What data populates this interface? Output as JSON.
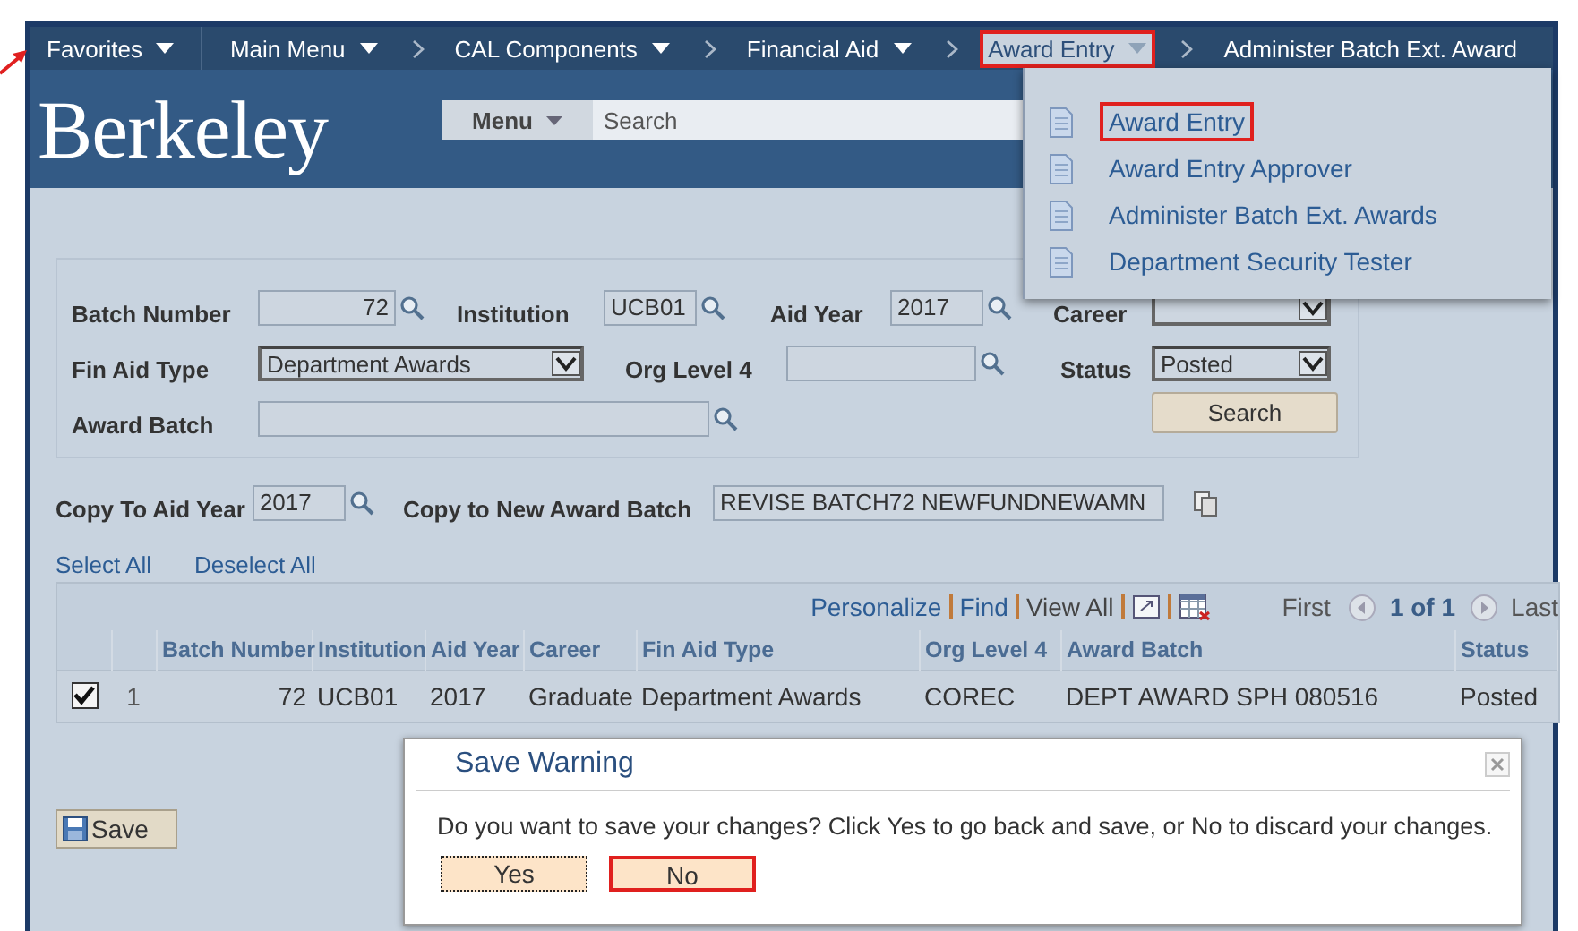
{
  "nav": {
    "items": [
      {
        "label": "Favorites",
        "caret": true,
        "open": false,
        "highlighted": false
      },
      {
        "label": "Main Menu",
        "caret": true,
        "open": false,
        "highlighted": false
      },
      {
        "label": "CAL Components",
        "caret": true,
        "open": false,
        "highlighted": false
      },
      {
        "label": "Financial Aid",
        "caret": true,
        "open": false,
        "highlighted": false
      },
      {
        "label": "Award Entry",
        "caret": true,
        "open": true,
        "highlighted": true
      },
      {
        "label": "Administer Batch Ext. Award",
        "caret": false,
        "open": false,
        "highlighted": false
      }
    ]
  },
  "header": {
    "logo": "Berkeley",
    "menu_button": "Menu",
    "search": {
      "placeholder": "Search"
    }
  },
  "dropdown": {
    "items": [
      {
        "label": "Award Entry",
        "highlighted": true
      },
      {
        "label": "Award Entry Approver",
        "highlighted": false
      },
      {
        "label": "Administer Batch Ext. Awards",
        "highlighted": false
      },
      {
        "label": "Department Security Tester",
        "highlighted": false
      }
    ]
  },
  "search_form": {
    "fields": [
      {
        "label": "Batch Number",
        "kind": "lookup",
        "value": "72"
      },
      {
        "label": "Institution",
        "kind": "lookup",
        "value": "UCB01"
      },
      {
        "label": "Aid Year",
        "kind": "lookup",
        "value": "2017"
      },
      {
        "label": "Career",
        "kind": "select"
      },
      {
        "label": "Fin Aid Type",
        "kind": "select",
        "value": "Department Awards"
      },
      {
        "label": "Org Level 4",
        "kind": "lookup"
      },
      {
        "label": "Status",
        "kind": "select",
        "value": "Posted"
      },
      {
        "label": "Award Batch",
        "kind": "lookup"
      }
    ],
    "search_button": "Search"
  },
  "copy_row": {
    "aid_year_label": "Copy To Aid Year",
    "aid_year": "2017",
    "batch_label": "Copy to New Award Batch",
    "batch": "REVISE BATCH72 NEWFUNDNEWAMN"
  },
  "links": [
    "Select All",
    "Deselect All"
  ],
  "grid": {
    "toolbar": [
      "Personalize",
      "Find",
      "View All"
    ],
    "first": "First",
    "range": "1 of 1",
    "last": "Last",
    "columns": [
      "Batch Number",
      "Institution",
      "Aid Year",
      "Career",
      "Fin Aid Type",
      "Org Level 4",
      "Award Batch",
      "Status"
    ],
    "rows": [
      {
        "checked": true,
        "number": "1",
        "cells": [
          "72",
          "UCB01",
          "2017",
          "Graduate",
          "Department Awards",
          "COREC",
          "DEPT AWARD SPH 080516",
          "Posted"
        ]
      }
    ]
  },
  "save_button": "Save",
  "dialog": {
    "title": "Save Warning",
    "message": "Do you want to save your changes? Click Yes to go back and save, or No to discard your changes.",
    "buttons": [
      {
        "label": "Yes",
        "focused": true,
        "highlighted": false
      },
      {
        "label": "No",
        "focused": false,
        "highlighted": true
      }
    ]
  }
}
